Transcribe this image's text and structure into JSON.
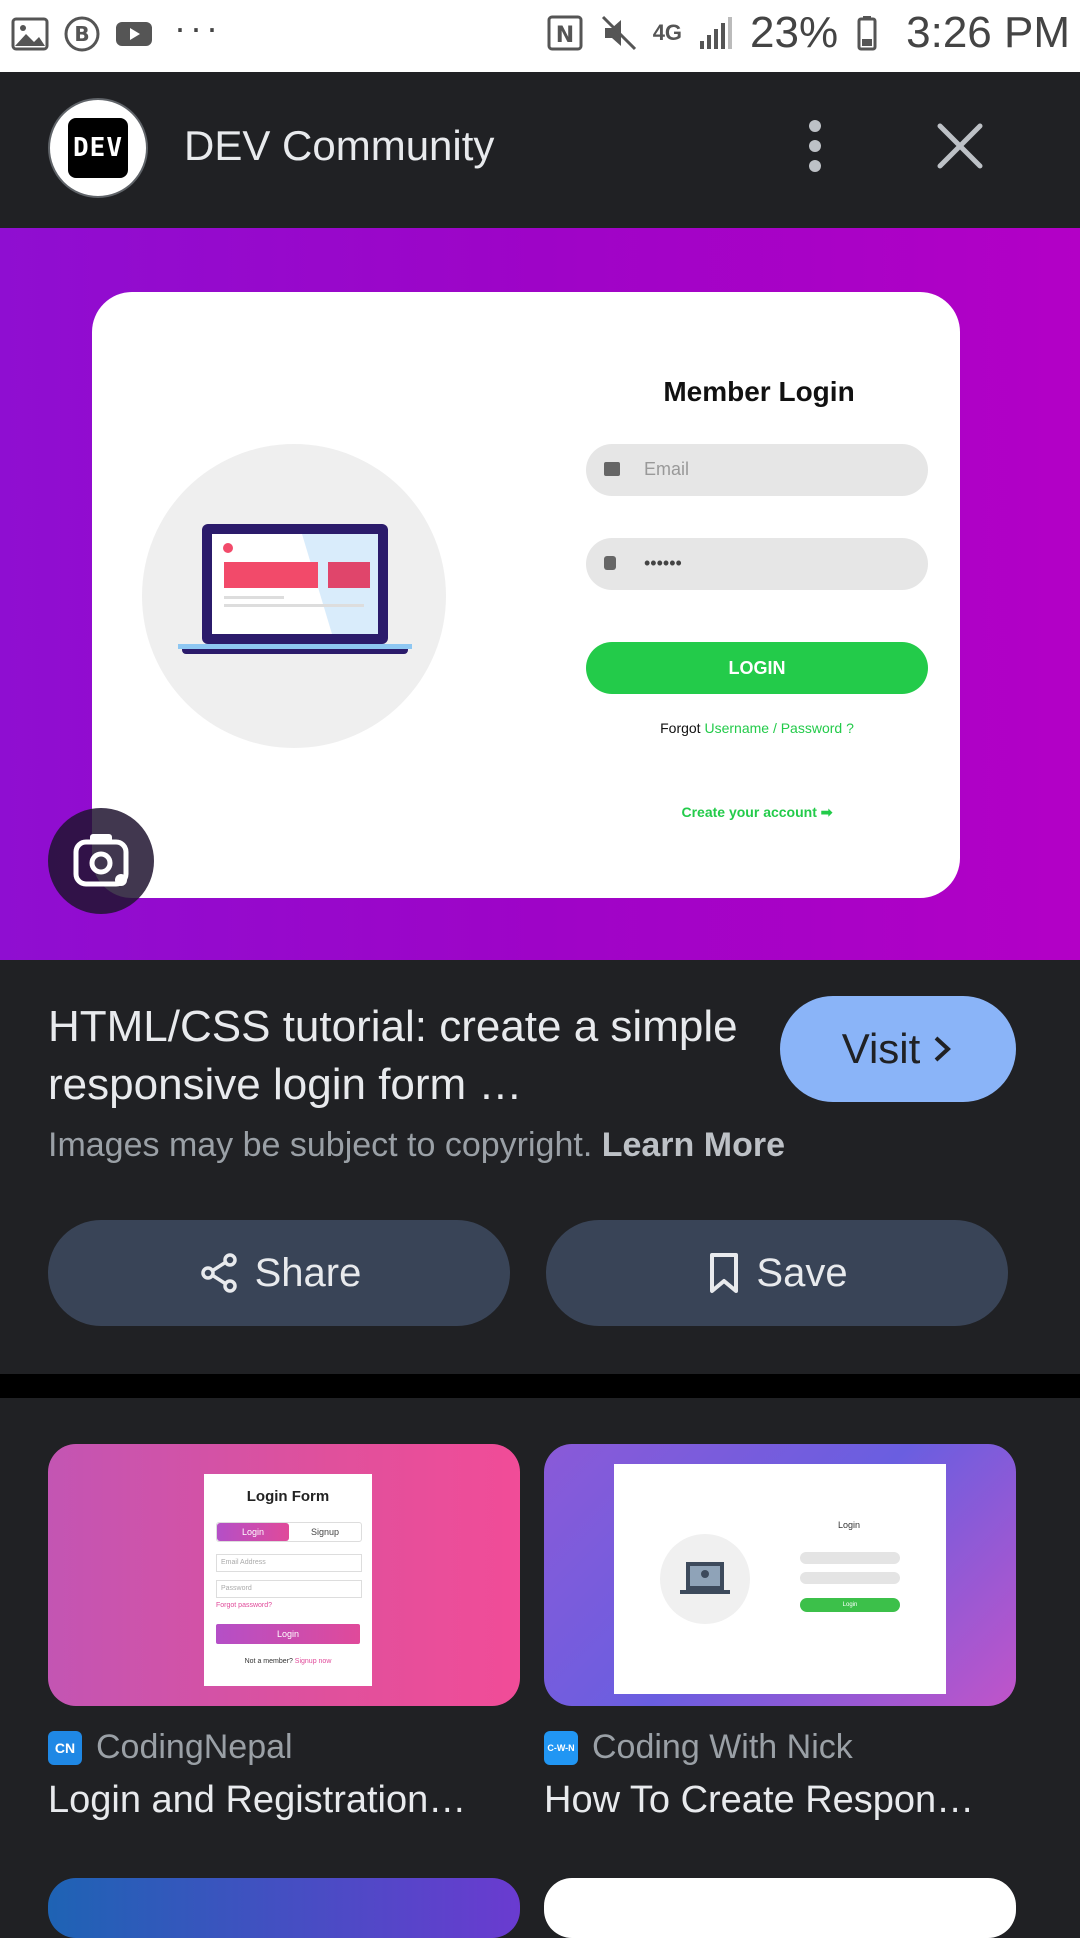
{
  "status_bar": {
    "battery": "23%",
    "time": "3:26 PM",
    "network": "4G"
  },
  "header": {
    "logo_text": "DEV",
    "site_name": "DEV Community"
  },
  "hero": {
    "login_title": "Member Login",
    "email_placeholder": "Email",
    "password_dots": "••••••",
    "login_button": "LOGIN",
    "forgot_prefix": "Forgot ",
    "forgot_link": "Username / Password ?",
    "create_account": "Create your account ➡"
  },
  "info": {
    "title": "HTML/CSS tutorial: create a simple responsive login form …",
    "visit_label": "Visit",
    "copyright_text": "Images may be subject to copyright.",
    "learn_more": "Learn More",
    "share_label": "Share",
    "save_label": "Save"
  },
  "results": [
    {
      "source": "CodingNepal",
      "favicon_text": "CN",
      "title": "Login and Registration…",
      "thumb": {
        "form_title": "Login Form",
        "tab_login": "Login",
        "tab_signup": "Signup",
        "email_ph": "Email Address",
        "password_ph": "Password",
        "forgot": "Forgot password?",
        "button": "Login",
        "footer_prefix": "Not a member? ",
        "footer_link": "Signup now"
      }
    },
    {
      "source": "Coding With Nick",
      "favicon_text": "C-W-N",
      "title": "How To Create Respon…",
      "thumb": {
        "form_title": "Login",
        "button": "Login"
      }
    }
  ],
  "colors": {
    "accent_blue": "#8ab4f8",
    "button_bg": "#394457",
    "login_green": "#23cb4a",
    "hero_purple": "#9e04c7"
  }
}
